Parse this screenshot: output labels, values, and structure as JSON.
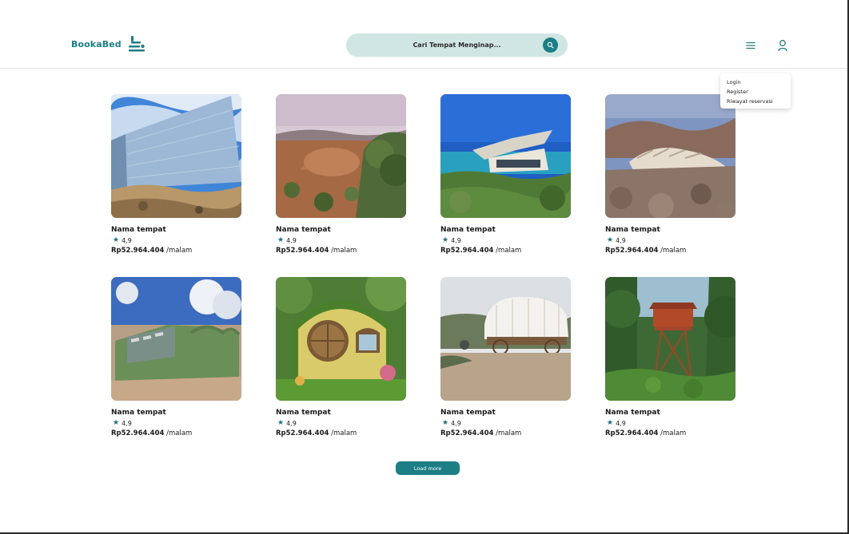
{
  "header": {
    "brand": "BookaBed",
    "search_placeholder": "Cari Tempat Menginap...",
    "accent_color": "#1c7f86",
    "icons": {
      "logo": "bed-icon",
      "search": "search-icon",
      "menu": "hamburger-icon",
      "user": "user-icon"
    }
  },
  "dropdown": {
    "items": [
      "Login",
      "Register",
      "Riwayat reservasi"
    ]
  },
  "listings": [
    {
      "name": "Nama tempat",
      "rating": "4,9",
      "price": "Rp52.964.404",
      "unit": "/malam"
    },
    {
      "name": "Nama tempat",
      "rating": "4,9",
      "price": "Rp52.964.404",
      "unit": "/malam"
    },
    {
      "name": "Nama tempat",
      "rating": "4,9",
      "price": "Rp52.964.404",
      "unit": "/malam"
    },
    {
      "name": "Nama tempat",
      "rating": "4,9",
      "price": "Rp52.964.404",
      "unit": "/malam"
    },
    {
      "name": "Nama tempat",
      "rating": "4,9",
      "price": "Rp52.964.404",
      "unit": "/malam"
    },
    {
      "name": "Nama tempat",
      "rating": "4,9",
      "price": "Rp52.964.404",
      "unit": "/malam"
    },
    {
      "name": "Nama tempat",
      "rating": "4,9",
      "price": "Rp52.964.404",
      "unit": "/malam"
    },
    {
      "name": "Nama tempat",
      "rating": "4,9",
      "price": "Rp52.964.404",
      "unit": "/malam"
    }
  ],
  "load_more_label": "Load more"
}
